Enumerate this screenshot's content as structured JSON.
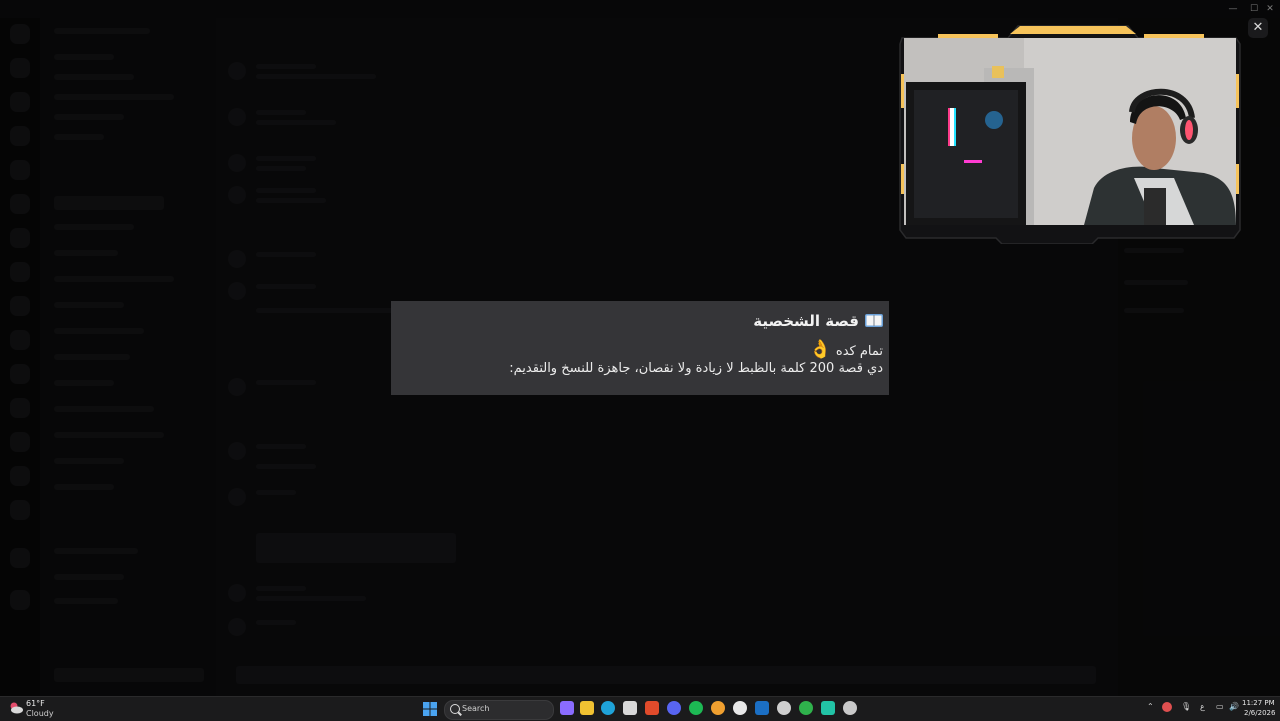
{
  "window": {
    "minimize": "—",
    "maximize": "☐",
    "close": "✕"
  },
  "lightbox": {
    "close_label": "✕",
    "title": "قصة الشخصية",
    "title_icon": "open-book-icon",
    "line1_text": "تمام كده",
    "line1_emoji": "👌",
    "line2_text": "دي قصة 200 كلمة بالظبط لا زيادة ولا نقصان، جاهزة للنسخ والتقديم:"
  },
  "taskbar": {
    "weather_temp": "61°F",
    "weather_condition": "Cloudy",
    "search_label": "Search",
    "clock_time": "11:27 PM",
    "clock_date": "2/6/2026",
    "tray_lang": "ع"
  },
  "colors": {
    "modal_bg": "#353538",
    "cam_accent": "#f6c35a",
    "taskbar_bg": "#1b1b1c"
  }
}
